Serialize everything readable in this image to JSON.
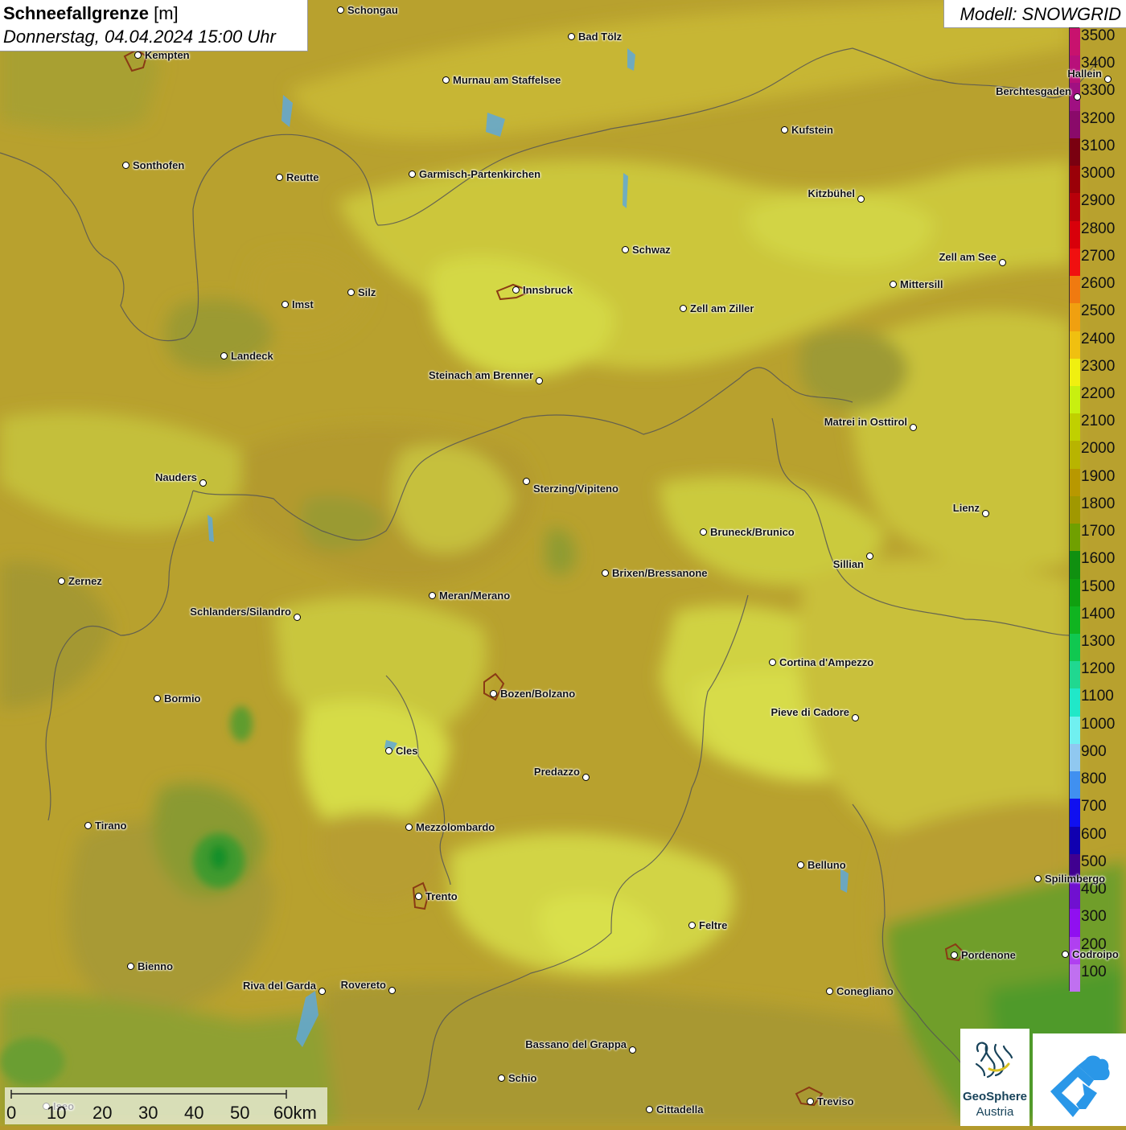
{
  "title": {
    "main": "Schneefallgrenze",
    "unit": "[m]",
    "datetime": "Donnerstag, 04.04.2024 15:00 Uhr"
  },
  "model": "Modell: SNOWGRID",
  "legend": {
    "labels": [
      "3500",
      "3400",
      "3300",
      "3200",
      "3100",
      "3000",
      "2900",
      "2800",
      "2700",
      "2600",
      "2500",
      "2400",
      "2300",
      "2200",
      "2100",
      "2000",
      "1900",
      "1800",
      "1700",
      "1600",
      "1500",
      "1400",
      "1300",
      "1200",
      "1100",
      "1000",
      "900",
      "800",
      "700",
      "600",
      "500",
      "400",
      "300",
      "200",
      "100"
    ],
    "colors": [
      "#c8126e",
      "#b8107a",
      "#a01082",
      "#8a0a6a",
      "#7a0010",
      "#9a0008",
      "#b8000a",
      "#d8000a",
      "#f01010",
      "#f07a10",
      "#f0a010",
      "#f0c010",
      "#f0f010",
      "#c8f010",
      "#c0d000",
      "#b8b400",
      "#b89800",
      "#a09800",
      "#70a000",
      "#109010",
      "#10a010",
      "#10b420",
      "#10c850",
      "#20d890",
      "#20e8c8",
      "#70f0f0",
      "#90c8f0",
      "#4090f0",
      "#1010f0",
      "#1000b0",
      "#400090",
      "#7010d0",
      "#9010f0",
      "#b040f0",
      "#c070f0"
    ]
  },
  "cities": [
    {
      "name": "Schongau"
    },
    {
      "name": "Bad Tölz"
    },
    {
      "name": "Kempten"
    },
    {
      "name": "Murnau am Staffelsee"
    },
    {
      "name": "Hallein"
    },
    {
      "name": "Berchtesgaden"
    },
    {
      "name": "Kufstein"
    },
    {
      "name": "Sonthofen"
    },
    {
      "name": "Reutte"
    },
    {
      "name": "Garmisch-Partenkirchen"
    },
    {
      "name": "Kitzbühel"
    },
    {
      "name": "Schwaz"
    },
    {
      "name": "Zell am See"
    },
    {
      "name": "Innsbruck"
    },
    {
      "name": "Mittersill"
    },
    {
      "name": "Silz"
    },
    {
      "name": "Imst"
    },
    {
      "name": "Zell am Ziller"
    },
    {
      "name": "Landeck"
    },
    {
      "name": "Steinach am Brenner"
    },
    {
      "name": "Matrei in Osttirol"
    },
    {
      "name": "Nauders"
    },
    {
      "name": "Sterzing/Vipiteno"
    },
    {
      "name": "Lienz"
    },
    {
      "name": "Bruneck/Brunico"
    },
    {
      "name": "Sillian"
    },
    {
      "name": "Brixen/Bressanone"
    },
    {
      "name": "Zernez"
    },
    {
      "name": "Meran/Merano"
    },
    {
      "name": "Schlanders/Silandro"
    },
    {
      "name": "Cortina d'Ampezzo"
    },
    {
      "name": "Bozen/Bolzano"
    },
    {
      "name": "Bormio"
    },
    {
      "name": "Pieve di Cadore"
    },
    {
      "name": "Cles"
    },
    {
      "name": "Predazzo"
    },
    {
      "name": "Tirano"
    },
    {
      "name": "Mezzolombardo"
    },
    {
      "name": "Belluno"
    },
    {
      "name": "Spilimbergo"
    },
    {
      "name": "Trento"
    },
    {
      "name": "Feltre"
    },
    {
      "name": "Pordenone"
    },
    {
      "name": "Codroipo"
    },
    {
      "name": "Bienno"
    },
    {
      "name": "Riva del Garda"
    },
    {
      "name": "Rovereto"
    },
    {
      "name": "Conegliano"
    },
    {
      "name": "Bassano del Grappa"
    },
    {
      "name": "Schio"
    },
    {
      "name": "Iseo"
    },
    {
      "name": "Treviso"
    },
    {
      "name": "Cittadella"
    }
  ],
  "scale": {
    "ticks": [
      "0",
      "10",
      "20",
      "30",
      "40",
      "50",
      "60km"
    ]
  },
  "logos": {
    "geosphere_line1": "GeoSphere",
    "geosphere_line2": "Austria"
  }
}
